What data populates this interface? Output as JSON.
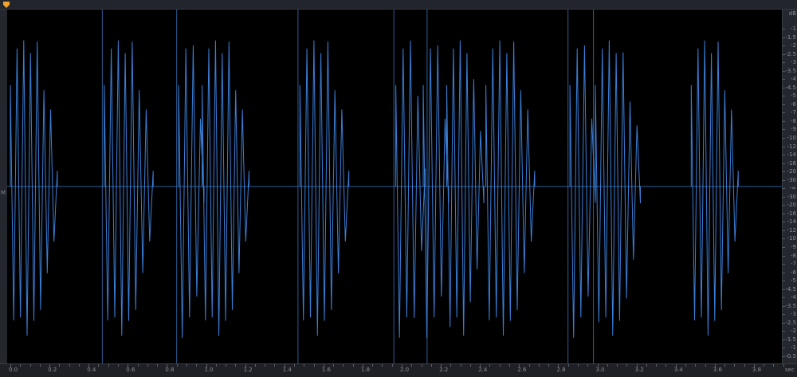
{
  "app": {
    "name": "waveform-editor"
  },
  "left_gutter": {
    "label": "M"
  },
  "db_scale": {
    "unit": "dB",
    "labels": [
      "-1",
      "-1.5",
      "-2",
      "-2.5",
      "-3",
      "-3.5",
      "-4",
      "-4.5",
      "-5",
      "-6",
      "-7",
      "-8",
      "-9",
      "-10",
      "-12",
      "-14",
      "-16",
      "-20",
      "-30",
      "-∞",
      "-30",
      "-20",
      "-16",
      "-14",
      "-12",
      "-10",
      "-9",
      "-8",
      "-7",
      "-6",
      "-5",
      "-4.5",
      "-4",
      "-3.5",
      "-3",
      "-2.5",
      "-2",
      "-1.5",
      "-1",
      "-0.5"
    ]
  },
  "time_ruler": {
    "unit": "sec",
    "labels": [
      "0.0",
      "0.2",
      "0.4",
      "0.6",
      "0.8",
      "1.0",
      "1.2",
      "1.4",
      "1.6",
      "1.8",
      "2.0",
      "2.2",
      "2.4",
      "2.6",
      "2.8",
      "3.0",
      "3.2",
      "3.4",
      "3.6",
      "3.8"
    ]
  },
  "waveform": {
    "color": "#3b7fd8",
    "center_color": "#2c5f9e",
    "marker_color": "#2f5c95",
    "duration_sec": 3.95,
    "marker_times_sec": [
      0.47,
      0.85,
      1.47,
      1.96,
      2.13,
      2.85,
      2.98
    ],
    "bursts_sec": [
      [
        0.0,
        0.24
      ],
      [
        0.48,
        0.73
      ],
      [
        0.86,
        0.99
      ],
      [
        0.98,
        1.22
      ],
      [
        1.48,
        1.73
      ],
      [
        1.97,
        2.12
      ],
      [
        2.11,
        2.24
      ],
      [
        2.23,
        2.42
      ],
      [
        2.43,
        2.68
      ],
      [
        2.86,
        2.99
      ],
      [
        2.99,
        3.22
      ],
      [
        3.48,
        3.72
      ]
    ]
  }
}
